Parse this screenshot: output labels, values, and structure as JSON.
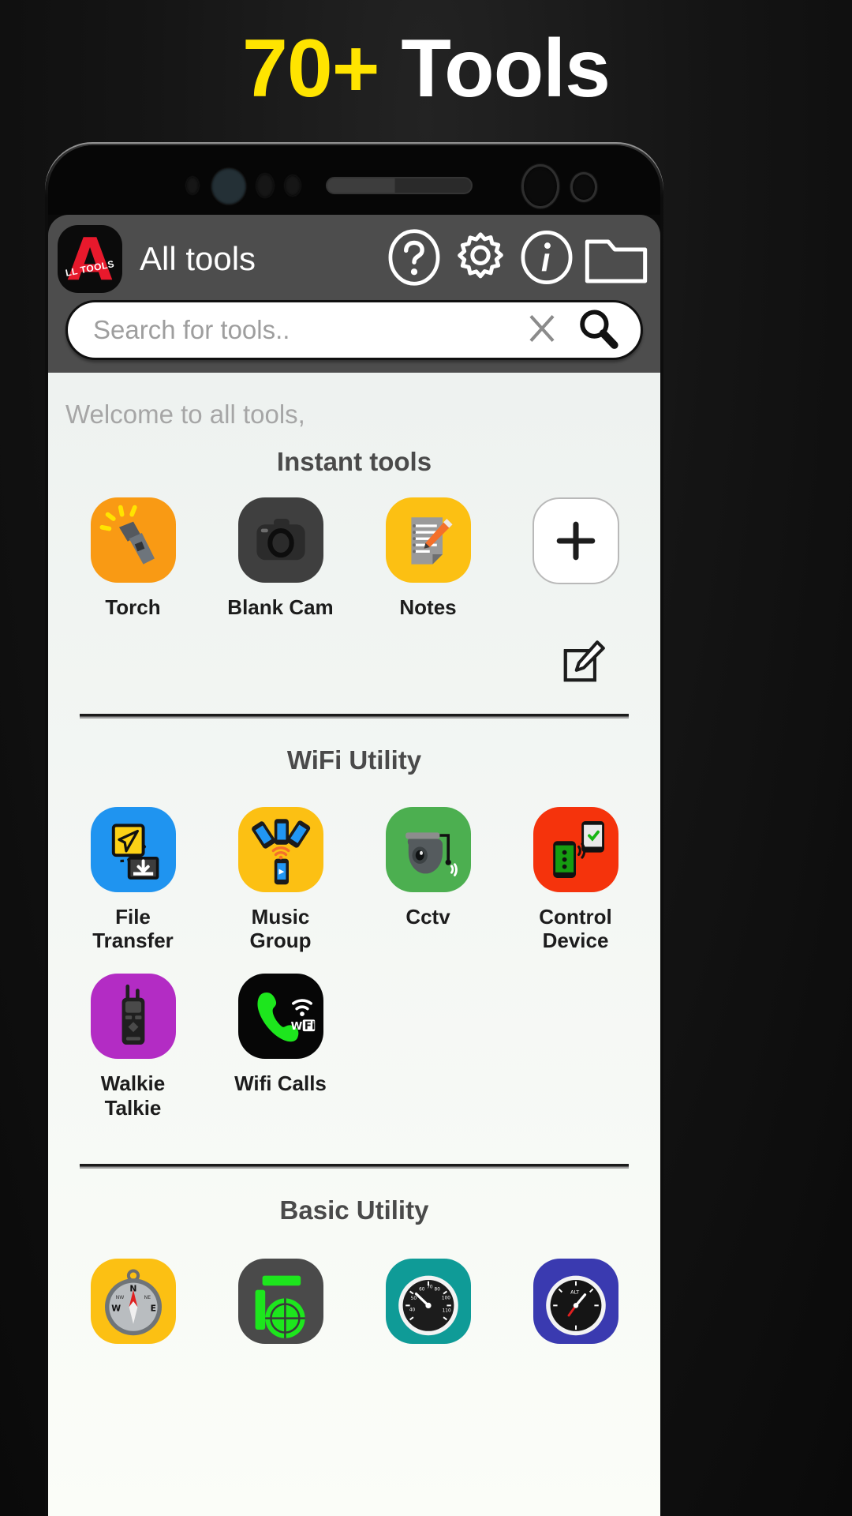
{
  "headline": {
    "number": "70+",
    "word": "Tools"
  },
  "app": {
    "logo_letter": "A",
    "logo_sub": "LL TOOLS",
    "title": "All tools",
    "actions": [
      {
        "name": "help-icon",
        "label": "?"
      },
      {
        "name": "settings-gear-icon",
        "label": "settings"
      },
      {
        "name": "info-icon",
        "label": "i"
      },
      {
        "name": "folder-icon",
        "label": "folder"
      }
    ],
    "search": {
      "placeholder": "Search for tools..",
      "value": ""
    },
    "welcome": "Welcome to all tools,"
  },
  "sections": [
    {
      "title": "Instant tools",
      "tiles": [
        {
          "label": "Torch",
          "icon": "torch-icon",
          "bg": "#f99a14"
        },
        {
          "label": "Blank Cam",
          "icon": "camera-icon",
          "bg": "#3f3f3f"
        },
        {
          "label": "Notes",
          "icon": "notes-icon",
          "bg": "#fcc013"
        },
        {
          "label": "",
          "icon": "add-icon",
          "bg": "#ffffff"
        }
      ],
      "has_edit": true,
      "edit_label": "edit"
    },
    {
      "title": "WiFi Utility",
      "tiles": [
        {
          "label": "File Transfer",
          "icon": "file-transfer-icon",
          "bg": "#1f94f0"
        },
        {
          "label": "Music Group",
          "icon": "music-group-icon",
          "bg": "#fcc013"
        },
        {
          "label": "Cctv",
          "icon": "cctv-icon",
          "bg": "#4caf50"
        },
        {
          "label": "Control Device",
          "icon": "control-device-icon",
          "bg": "#f5330c"
        },
        {
          "label": "Walkie Talkie",
          "icon": "walkie-talkie-icon",
          "bg": "#b32cc4"
        },
        {
          "label": "Wifi Calls",
          "icon": "wifi-calls-icon",
          "bg": "#060606"
        }
      ],
      "has_edit": false
    },
    {
      "title": "Basic Utility",
      "tiles": [
        {
          "label": "",
          "icon": "compass-icon",
          "bg": "#fcc013"
        },
        {
          "label": "",
          "icon": "level-icon",
          "bg": "#4a4a4a"
        },
        {
          "label": "",
          "icon": "speedometer-icon",
          "bg": "#0f9b97"
        },
        {
          "label": "",
          "icon": "altimeter-icon",
          "bg": "#3a3ab0"
        }
      ],
      "has_edit": false
    }
  ],
  "colors": {
    "accent_yellow": "#ffe400",
    "brand_red": "#e8192c",
    "appbar": "#4d4d4d",
    "page_bg": "#0a0a0a"
  }
}
